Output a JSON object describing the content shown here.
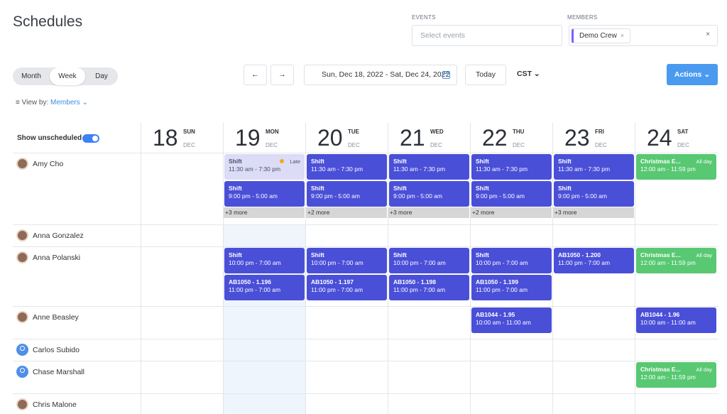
{
  "header": {
    "title": "Schedules",
    "events_label": "EVENTS",
    "events_placeholder": "Select events",
    "members_label": "MEMBERS",
    "member_chip": "Demo Crew",
    "chip_close": "×",
    "clear": "×"
  },
  "toolbar": {
    "views": [
      "Month",
      "Week",
      "Day"
    ],
    "active_view": "Week",
    "prev": "←",
    "next": "→",
    "date_range": "Sun, Dec 18, 2022 - Sat, Dec 24, 2022",
    "today": "Today",
    "timezone": "CST",
    "actions": "Actions",
    "view_by_label": "View by:",
    "view_by_value": "Members"
  },
  "grid": {
    "show_unscheduled": "Show unscheduled",
    "days": [
      {
        "num": "18",
        "dow": "SUN",
        "mon": "DEC"
      },
      {
        "num": "19",
        "dow": "MON",
        "mon": "DEC"
      },
      {
        "num": "20",
        "dow": "TUE",
        "mon": "DEC"
      },
      {
        "num": "21",
        "dow": "WED",
        "mon": "DEC"
      },
      {
        "num": "22",
        "dow": "THU",
        "mon": "DEC"
      },
      {
        "num": "23",
        "dow": "FRI",
        "mon": "DEC"
      },
      {
        "num": "24",
        "dow": "SAT",
        "mon": "DEC"
      }
    ],
    "members": [
      {
        "name": "Amy Cho",
        "avatar": "photo"
      },
      {
        "name": "Anna Gonzalez",
        "avatar": "photo"
      },
      {
        "name": "Anna Polanski",
        "avatar": "photo"
      },
      {
        "name": "Anne Beasley",
        "avatar": "photo"
      },
      {
        "name": "Carlos Subido",
        "avatar": "generic"
      },
      {
        "name": "Chase Marshall",
        "avatar": "generic"
      },
      {
        "name": "Chris Malone",
        "avatar": "photo"
      }
    ],
    "events": [
      {
        "row": 0,
        "day": 1,
        "slot": 0,
        "title": "Shift",
        "time": "11:30 am - 7:30 pm",
        "style": "light",
        "tag": "Late"
      },
      {
        "row": 0,
        "day": 2,
        "slot": 0,
        "title": "Shift",
        "time": "11:30 am - 7:30 pm",
        "style": "blue"
      },
      {
        "row": 0,
        "day": 3,
        "slot": 0,
        "title": "Shift",
        "time": "11:30 am - 7:30 pm",
        "style": "blue"
      },
      {
        "row": 0,
        "day": 4,
        "slot": 0,
        "title": "Shift",
        "time": "11:30 am - 7:30 pm",
        "style": "blue"
      },
      {
        "row": 0,
        "day": 5,
        "slot": 0,
        "title": "Shift",
        "time": "11:30 am - 7:30 pm",
        "style": "blue"
      },
      {
        "row": 0,
        "day": 6,
        "slot": 0,
        "title": "Christmas E...",
        "time": "12:00 am - 11:59 pm",
        "style": "green",
        "tag": "All day"
      },
      {
        "row": 0,
        "day": 1,
        "slot": 1,
        "title": "Shift",
        "time": "9:00 pm - 5:00 am",
        "style": "blue"
      },
      {
        "row": 0,
        "day": 2,
        "slot": 1,
        "title": "Shift",
        "time": "9:00 pm - 5:00 am",
        "style": "blue"
      },
      {
        "row": 0,
        "day": 3,
        "slot": 1,
        "title": "Shift",
        "time": "9:00 pm - 5:00 am",
        "style": "blue"
      },
      {
        "row": 0,
        "day": 4,
        "slot": 1,
        "title": "Shift",
        "time": "9:00 pm - 5:00 am",
        "style": "blue"
      },
      {
        "row": 0,
        "day": 5,
        "slot": 1,
        "title": "Shift",
        "time": "9:00 pm - 5:00 am",
        "style": "blue"
      },
      {
        "row": 2,
        "day": 1,
        "slot": 0,
        "title": "Shift",
        "time": "10:00 pm - 7:00 am",
        "style": "blue"
      },
      {
        "row": 2,
        "day": 2,
        "slot": 0,
        "title": "Shift",
        "time": "10:00 pm - 7:00 am",
        "style": "blue"
      },
      {
        "row": 2,
        "day": 3,
        "slot": 0,
        "title": "Shift",
        "time": "10:00 pm - 7:00 am",
        "style": "blue"
      },
      {
        "row": 2,
        "day": 4,
        "slot": 0,
        "title": "Shift",
        "time": "10:00 pm - 7:00 am",
        "style": "blue"
      },
      {
        "row": 2,
        "day": 5,
        "slot": 0,
        "title": "AB1050 - 1.200",
        "time": "11:00 pm - 7:00 am",
        "style": "blue"
      },
      {
        "row": 2,
        "day": 6,
        "slot": 0,
        "title": "Christmas E...",
        "time": "12:00 am - 11:59 pm",
        "style": "green",
        "tag": "All day"
      },
      {
        "row": 2,
        "day": 1,
        "slot": 1,
        "title": "AB1050 - 1.196",
        "time": "11:00 pm - 7:00 am",
        "style": "blue"
      },
      {
        "row": 2,
        "day": 2,
        "slot": 1,
        "title": "AB1050 - 1.197",
        "time": "11:00 pm - 7:00 am",
        "style": "blue"
      },
      {
        "row": 2,
        "day": 3,
        "slot": 1,
        "title": "AB1050 - 1.198",
        "time": "11:00 pm - 7:00 am",
        "style": "blue"
      },
      {
        "row": 2,
        "day": 4,
        "slot": 1,
        "title": "AB1050 - 1.199",
        "time": "11:00 pm - 7:00 am",
        "style": "blue"
      },
      {
        "row": 3,
        "day": 4,
        "slot": 0,
        "title": "AB1044 - 1.95",
        "time": "10:00 am - 11:00 am",
        "style": "blue"
      },
      {
        "row": 3,
        "day": 6,
        "slot": 0,
        "title": "AB1044 - 1.96",
        "time": "10:00 am - 11:00 am",
        "style": "blue"
      },
      {
        "row": 5,
        "day": 6,
        "slot": 0,
        "title": "Christmas E...",
        "time": "12:00 am - 11:59 pm",
        "style": "green",
        "tag": "All day"
      }
    ],
    "more": [
      {
        "row": 0,
        "day": 1,
        "label": "+3 more"
      },
      {
        "row": 0,
        "day": 2,
        "label": "+2 more"
      },
      {
        "row": 0,
        "day": 3,
        "label": "+3 more"
      },
      {
        "row": 0,
        "day": 4,
        "label": "+2 more"
      },
      {
        "row": 0,
        "day": 5,
        "label": "+3 more"
      }
    ]
  }
}
